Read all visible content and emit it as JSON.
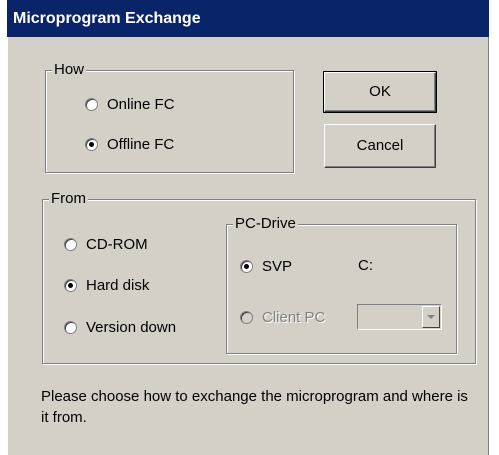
{
  "window": {
    "title": "Microprogram Exchange"
  },
  "how_group": {
    "legend": "How",
    "options": [
      {
        "label": "Online FC",
        "selected": false
      },
      {
        "label": "Offline FC",
        "selected": true
      }
    ]
  },
  "buttons": {
    "ok": "OK",
    "cancel": "Cancel"
  },
  "from_group": {
    "legend": "From",
    "options": [
      {
        "label": "CD-ROM",
        "selected": false
      },
      {
        "label": "Hard disk",
        "selected": true
      },
      {
        "label": "Version down",
        "selected": false
      }
    ]
  },
  "pc_drive_group": {
    "legend": "PC-Drive",
    "svp_label": "SVP",
    "svp_selected": true,
    "drive_value": "C:",
    "client_pc_label": "Client PC",
    "client_pc_enabled": false,
    "client_pc_drive_value": ""
  },
  "message": "Please choose how to exchange the microprogram and where is it from."
}
